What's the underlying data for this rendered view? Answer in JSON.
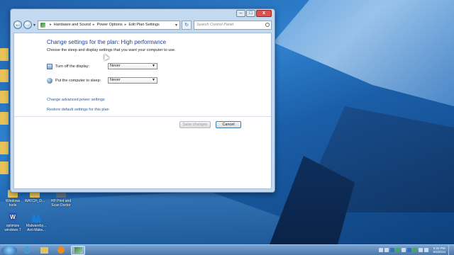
{
  "window": {
    "breadcrumb": [
      "Hardware and Sound",
      "Power Options",
      "Edit Plan Settings"
    ],
    "search_placeholder": "Search Control Panel",
    "controls": {
      "minimize": "–",
      "maximize": "□",
      "close": "x"
    }
  },
  "page": {
    "title": "Change settings for the plan: High performance",
    "subtitle": "Choose the sleep and display settings that you want your computer to use.",
    "settings": [
      {
        "label": "Turn off the display:",
        "value": "Never",
        "icon": "display-icon"
      },
      {
        "label": "Put the computer to sleep:",
        "value": "Never",
        "icon": "sleep-icon"
      }
    ],
    "links": {
      "advanced": "Change advanced power settings",
      "restore": "Restore default settings for this plan"
    },
    "buttons": {
      "save": "Save changes",
      "cancel": "Cancel"
    }
  },
  "desktop": {
    "icons": [
      {
        "label": "Windows tools"
      },
      {
        "label": "WATCH_D..."
      },
      {
        "label": "HP Print and Scan Doctor"
      },
      {
        "label": "optimize windows 7"
      },
      {
        "label": "Malwareby... Anti-Malw..."
      }
    ]
  },
  "taskbar": {
    "time": "6:31 PM",
    "date": "6/4/2014"
  },
  "colors": {
    "title_blue": "#1e3f9b",
    "link_blue": "#1f5fb8",
    "taskbar": "#5a86b8"
  }
}
